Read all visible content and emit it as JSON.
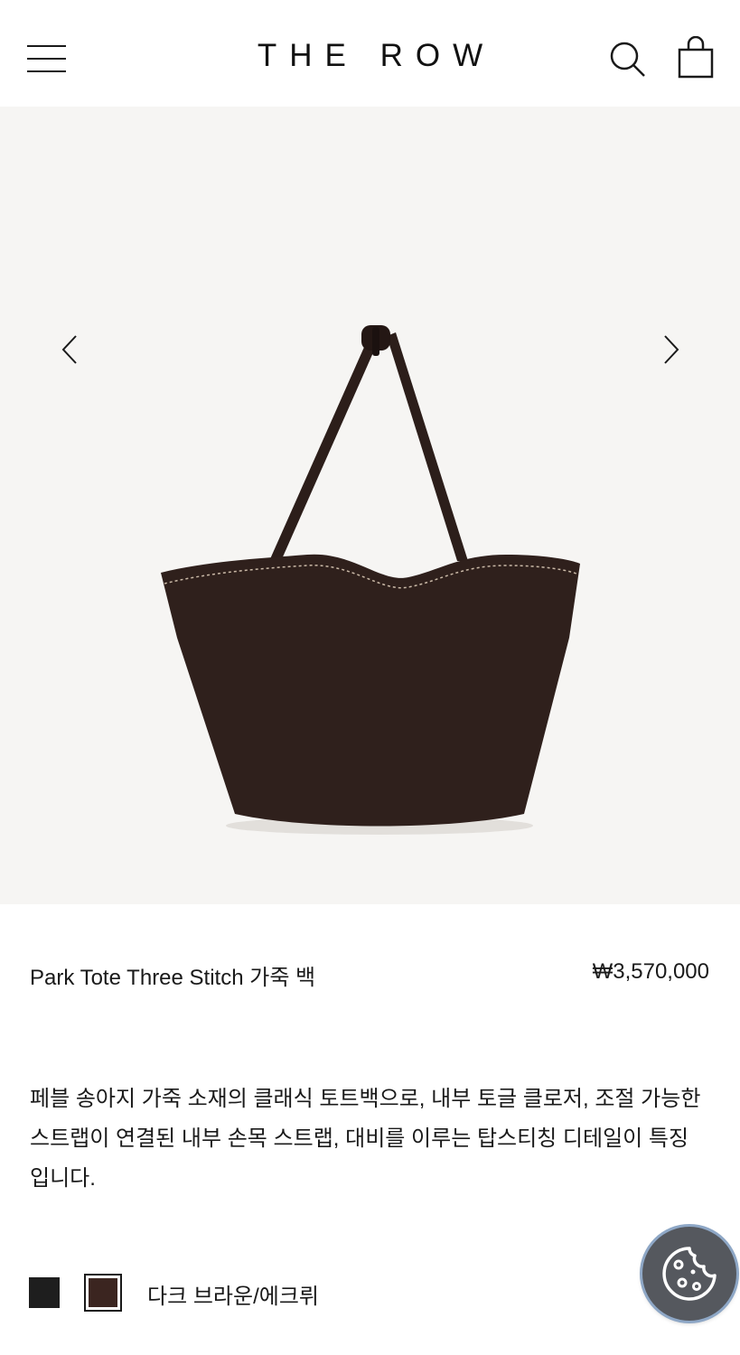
{
  "header": {
    "logo": "THE ROW",
    "menu_icon": "hamburger-menu-icon",
    "search_icon": "search-icon",
    "bag_icon": "shopping-bag-icon"
  },
  "gallery": {
    "prev_icon": "chevron-left-icon",
    "next_icon": "chevron-right-icon",
    "image_alt": "Park Tote Three Stitch 가죽 백"
  },
  "product": {
    "title": "Park Tote Three Stitch 가죽 백",
    "price": "₩3,570,000",
    "description": "페블 송아지 가죽 소재의 클래식 토트백으로, 내부 토글 클로저, 조절 가능한 스트랩이 연결된 내부 손목 스트랩, 대비를 이루는 탑스티칭 디테일이 특징입니다.",
    "colors": [
      {
        "name": "black",
        "hex": "#1e1e1e",
        "selected": false
      },
      {
        "name": "dark-brown",
        "hex": "#3b2520",
        "selected": true
      }
    ],
    "selected_color_label": "다크 브라운/에크뤼"
  },
  "cookie_button": {
    "icon": "cookie-icon",
    "bg_color": "#55585e"
  },
  "colors": {
    "gallery_bg": "#f6f5f3",
    "text": "#1a1a1a",
    "bag_leather": "#2f201c"
  }
}
